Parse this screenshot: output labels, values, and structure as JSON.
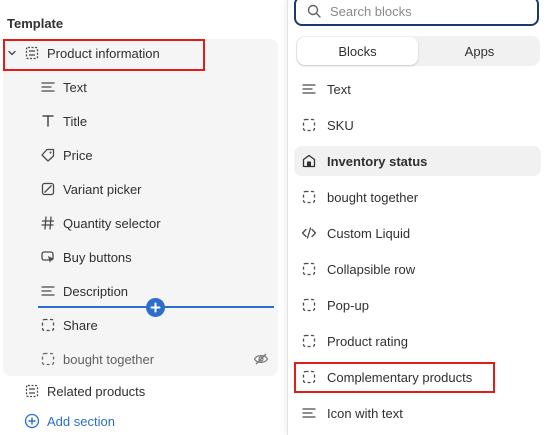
{
  "template": {
    "title": "Template",
    "group_label": "Product information",
    "blocks": [
      {
        "label": "Text",
        "icon": "text-lines-icon"
      },
      {
        "label": "Title",
        "icon": "title-icon"
      },
      {
        "label": "Price",
        "icon": "price-tag-icon"
      },
      {
        "label": "Variant picker",
        "icon": "variant-picker-icon"
      },
      {
        "label": "Quantity selector",
        "icon": "hash-icon"
      },
      {
        "label": "Buy buttons",
        "icon": "cursor-click-icon"
      },
      {
        "label": "Description",
        "icon": "text-lines-icon"
      },
      {
        "label": "Share",
        "icon": "dashed-square-icon"
      },
      {
        "label": "bought together",
        "icon": "dashed-square-icon"
      }
    ],
    "related_label": "Related products",
    "add_section_label": "Add section"
  },
  "popover": {
    "search_placeholder": "Search blocks",
    "tabs": [
      "Blocks",
      "Apps"
    ],
    "active_tab": "Blocks",
    "blocks": [
      {
        "label": "Text",
        "icon": "text-lines-icon"
      },
      {
        "label": "SKU",
        "icon": "dashed-square-icon"
      },
      {
        "label": "Inventory status",
        "icon": "inventory-icon"
      },
      {
        "label": "bought together",
        "icon": "dashed-square-icon"
      },
      {
        "label": "Custom Liquid",
        "icon": "code-icon"
      },
      {
        "label": "Collapsible row",
        "icon": "dashed-square-icon"
      },
      {
        "label": "Pop-up",
        "icon": "dashed-square-icon"
      },
      {
        "label": "Product rating",
        "icon": "dashed-square-icon"
      },
      {
        "label": "Complementary products",
        "icon": "dashed-square-icon"
      },
      {
        "label": "Icon with text",
        "icon": "text-lines-icon"
      }
    ]
  },
  "colors": {
    "accent": "#2c6ecb",
    "highlight": "#e21b1b",
    "search_border": "#1a3a6b"
  }
}
